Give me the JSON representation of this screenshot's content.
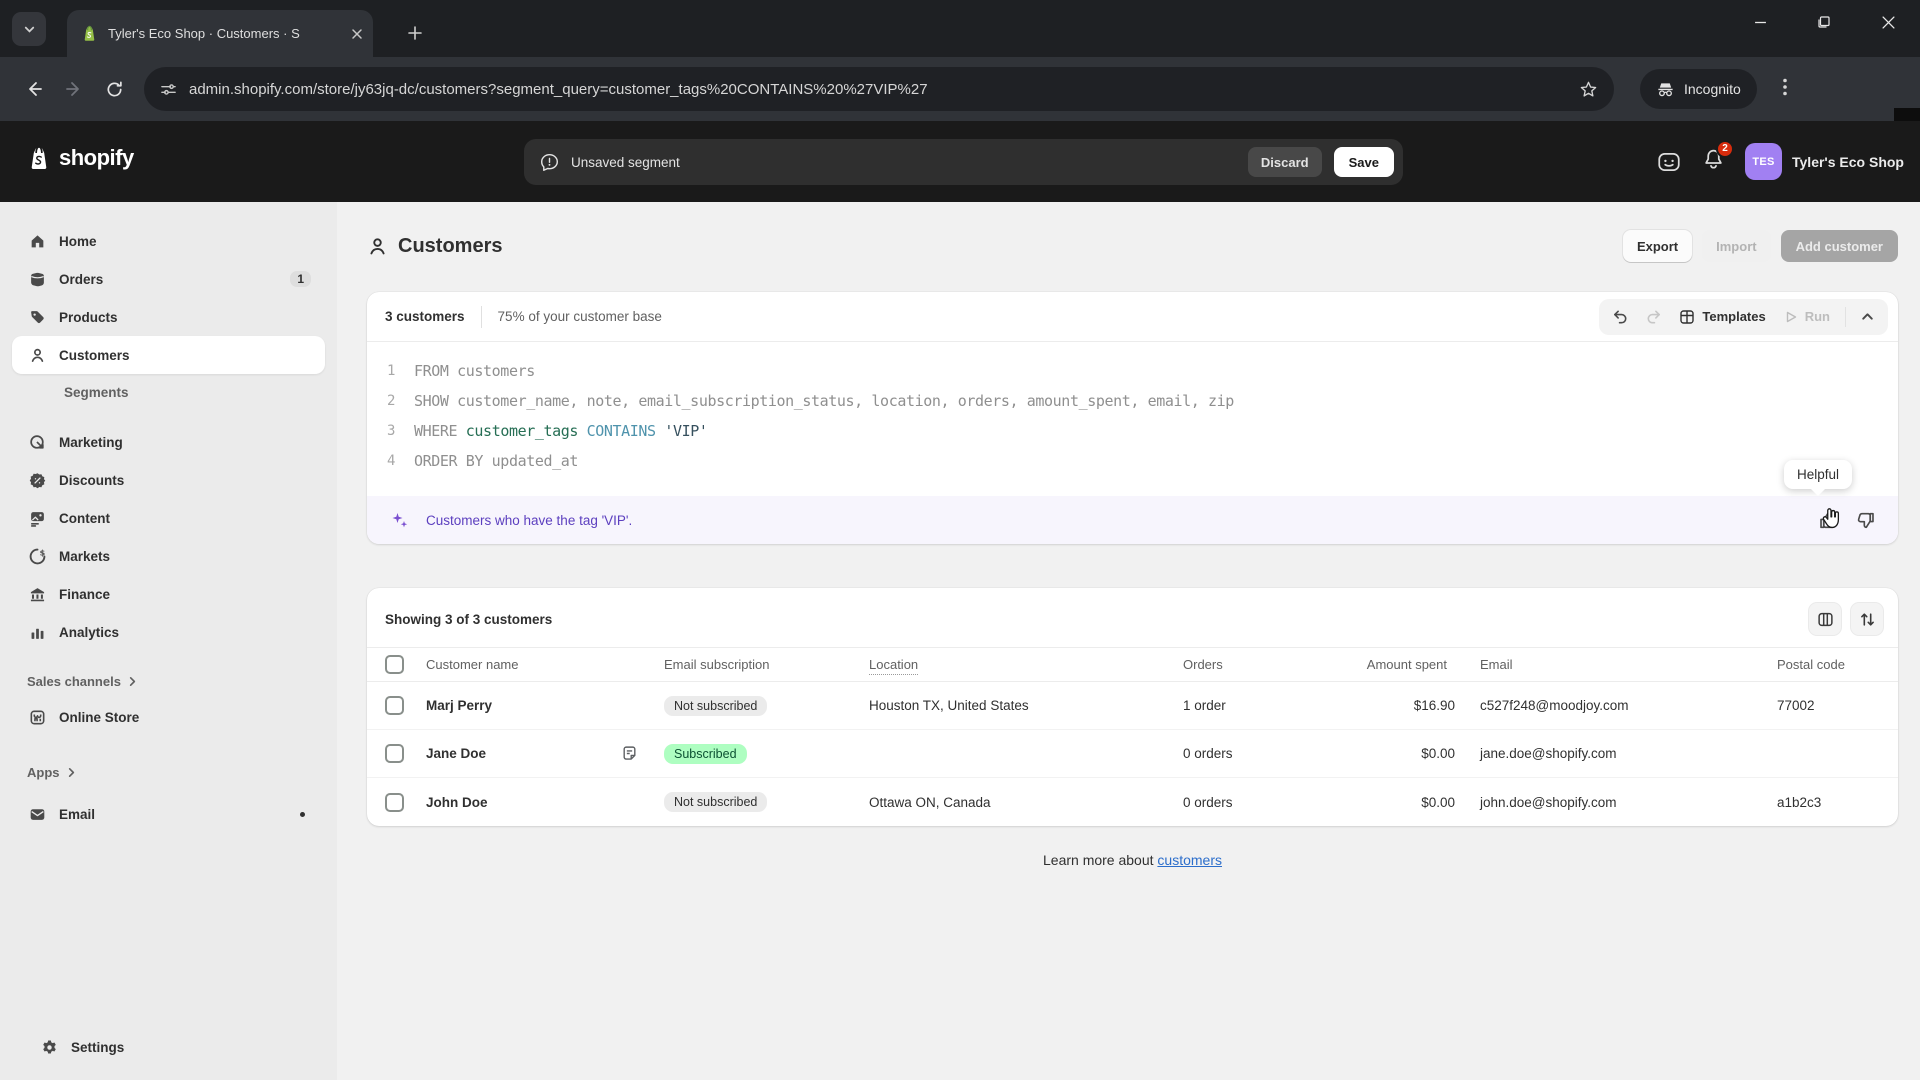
{
  "browser": {
    "tab_title": "Tyler's Eco Shop · Customers · S",
    "url": "admin.shopify.com/store/jy63jq-dc/customers?segment_query=customer_tags%20CONTAINS%20%27VIP%27",
    "incognito_label": "Incognito"
  },
  "topbar": {
    "logo_text": "shopify",
    "unsaved_message": "Unsaved segment",
    "discard_label": "Discard",
    "save_label": "Save",
    "notification_count": "2",
    "store_initials": "TES",
    "store_name": "Tyler's Eco Shop"
  },
  "sidebar": {
    "items": [
      {
        "id": "home",
        "label": "Home",
        "icon": "home"
      },
      {
        "id": "orders",
        "label": "Orders",
        "icon": "orders",
        "badge": "1"
      },
      {
        "id": "products",
        "label": "Products",
        "icon": "products"
      },
      {
        "id": "customers",
        "label": "Customers",
        "icon": "customers",
        "active": true
      },
      {
        "id": "segments",
        "label": "Segments",
        "sub": true
      },
      {
        "id": "marketing",
        "label": "Marketing",
        "icon": "marketing",
        "gap": 13
      },
      {
        "id": "discounts",
        "label": "Discounts",
        "icon": "discounts"
      },
      {
        "id": "content",
        "label": "Content",
        "icon": "content"
      },
      {
        "id": "markets",
        "label": "Markets",
        "icon": "markets"
      },
      {
        "id": "finance",
        "label": "Finance",
        "icon": "finance"
      },
      {
        "id": "analytics",
        "label": "Analytics",
        "icon": "analytics"
      },
      {
        "id": "sales-channels",
        "label": "Sales channels",
        "header": true,
        "gap": 13
      },
      {
        "id": "online-store",
        "label": "Online Store",
        "icon": "store"
      },
      {
        "id": "apps",
        "label": "Apps",
        "header": true,
        "gap": 19
      },
      {
        "id": "email",
        "label": "Email",
        "icon": "email",
        "dot": true,
        "gap": 6
      }
    ],
    "settings_label": "Settings"
  },
  "page": {
    "title": "Customers",
    "export_label": "Export",
    "import_label": "Import",
    "add_customer_label": "Add customer"
  },
  "editor": {
    "count_label": "3 customers",
    "base_label": "75% of your customer base",
    "templates_label": "Templates",
    "run_label": "Run",
    "query_lines": [
      {
        "num": "1",
        "tokens": [
          {
            "text": "FROM customers",
            "style": "muted"
          }
        ]
      },
      {
        "num": "2",
        "tokens": [
          {
            "text": "SHOW customer_name, note, email_subscription_status, location, orders, amount_spent, email, zip",
            "style": "muted"
          }
        ]
      },
      {
        "num": "3",
        "tokens": [
          {
            "text": "WHERE ",
            "style": "muted"
          },
          {
            "text": "customer_tags",
            "style": "field"
          },
          {
            "text": " CONTAINS",
            "style": "op"
          },
          {
            "text": " 'VIP'",
            "style": "value"
          }
        ]
      },
      {
        "num": "4",
        "tokens": [
          {
            "text": "ORDER BY updated_at",
            "style": "muted"
          }
        ]
      }
    ],
    "hint_text": "Customers who have the tag 'VIP'.",
    "tooltip_label": "Helpful"
  },
  "table": {
    "summary": "Showing 3 of 3 customers",
    "columns": [
      "Customer name",
      "Email subscription",
      "Location",
      "Orders",
      "Amount spent",
      "Email",
      "Postal code"
    ],
    "rows": [
      {
        "name": "Marj Perry",
        "note": false,
        "subscription": "Not subscribed",
        "subscribed": false,
        "location": "Houston TX, United States",
        "orders": "1 order",
        "amount": "$16.90",
        "email": "c527f248@moodjoy.com",
        "postal": "77002"
      },
      {
        "name": "Jane Doe",
        "note": true,
        "subscription": "Subscribed",
        "subscribed": true,
        "location": "",
        "orders": "0 orders",
        "amount": "$0.00",
        "email": "jane.doe@shopify.com",
        "postal": ""
      },
      {
        "name": "John Doe",
        "note": false,
        "subscription": "Not subscribed",
        "subscribed": false,
        "location": "Ottawa ON, Canada",
        "orders": "0 orders",
        "amount": "$0.00",
        "email": "john.doe@shopify.com",
        "postal": "a1b2c3"
      }
    ],
    "footer_prefix": "Learn more about",
    "footer_link": "customers"
  },
  "colors": {
    "avatar_purple": "#a180f2",
    "hint_purple": "#5c3fbf",
    "subscribed_badge": "#aefec1",
    "notification_red": "#d72c0d",
    "link_blue": "#2c6ecb"
  }
}
